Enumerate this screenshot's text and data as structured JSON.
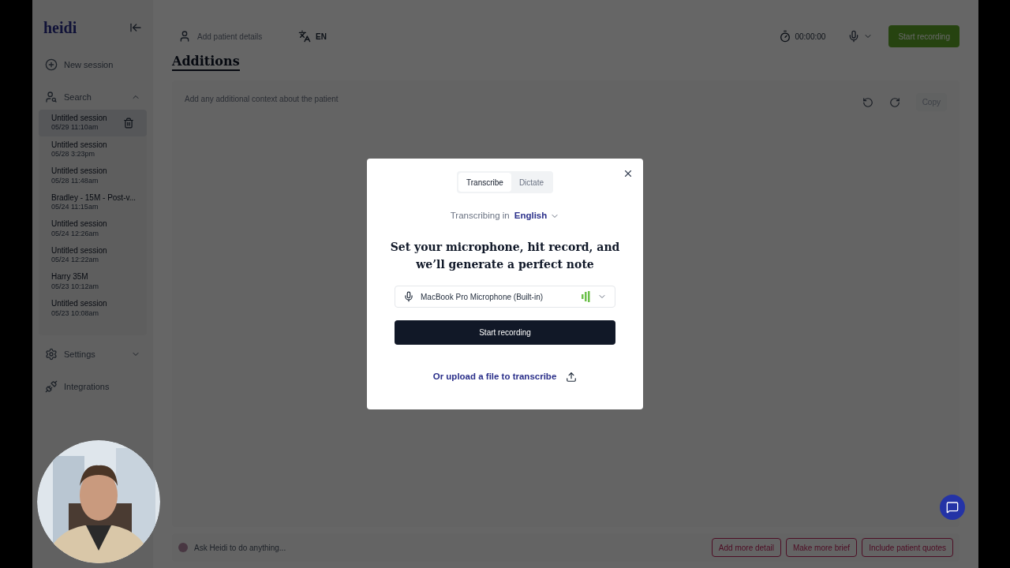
{
  "sidebar": {
    "logo": "heidi",
    "new_session": "New session",
    "search": {
      "label": "Search",
      "expanded": true
    },
    "sessions": [
      {
        "title": "Untitled session",
        "time": "05/29 11:10am",
        "selected": true
      },
      {
        "title": "Untitled session",
        "time": "05/28 3:23pm",
        "selected": false
      },
      {
        "title": "Untitled session",
        "time": "05/28 11:48am",
        "selected": false
      },
      {
        "title": "Bradley - 15M - Post-v...",
        "time": "05/24 11:15am",
        "selected": false
      },
      {
        "title": "Untitled session",
        "time": "05/24 12:26am",
        "selected": false
      },
      {
        "title": "Untitled session",
        "time": "05/24 12:22am",
        "selected": false
      },
      {
        "title": "Harry 35M",
        "time": "05/23 10:12am",
        "selected": false
      },
      {
        "title": "Untitled session",
        "time": "05/23 10:08am",
        "selected": false
      }
    ],
    "settings": {
      "label": "Settings",
      "expanded": false
    },
    "integrations": "Integrations"
  },
  "toolbar": {
    "patient_placeholder": "Add patient details",
    "language": "EN",
    "timer": "00:00:00",
    "start_recording": "Start recording"
  },
  "page_title": "Additions",
  "editor": {
    "placeholder": "Add any additional context about the patient",
    "copy": "Copy"
  },
  "ask_bar": {
    "placeholder": "Ask Heidi to do anything...",
    "actions": [
      "Add more detail",
      "Make more brief",
      "Include patient quotes"
    ]
  },
  "modal": {
    "tabs": [
      {
        "label": "Transcribe",
        "selected": true
      },
      {
        "label": "Dictate",
        "selected": false
      }
    ],
    "language_prefix": "Transcribing in",
    "language": "English",
    "heading": "Set your microphone, hit record, and we’ll generate a perfect note",
    "microphone": "MacBook Pro Microphone (Built-in)",
    "start": "Start recording",
    "upload": "Or upload a file to transcribe"
  }
}
